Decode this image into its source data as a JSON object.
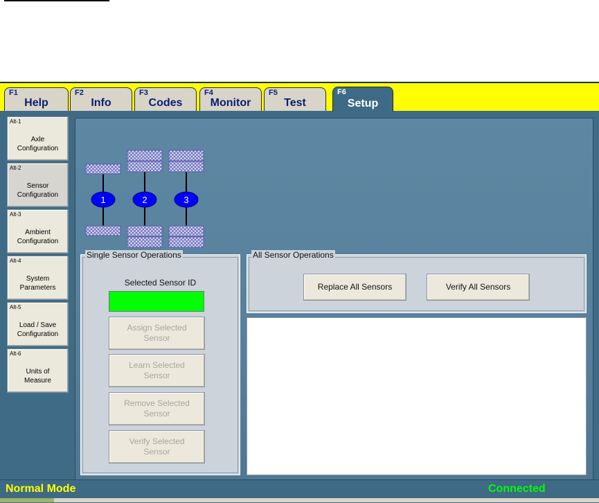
{
  "tabs": [
    {
      "fkey": "F1",
      "label": "Help"
    },
    {
      "fkey": "F2",
      "label": "Info"
    },
    {
      "fkey": "F3",
      "label": "Codes"
    },
    {
      "fkey": "F4",
      "label": "Monitor"
    },
    {
      "fkey": "F5",
      "label": "Test"
    },
    {
      "fkey": "F6",
      "label": "Setup"
    }
  ],
  "active_tab": "Setup",
  "sidebar": {
    "items": [
      {
        "key": "Alt-1",
        "label": "Axle\nConfiguration"
      },
      {
        "key": "Alt-2",
        "label": "Sensor\nConfiguration"
      },
      {
        "key": "Alt-3",
        "label": "Ambient\nConfiguration"
      },
      {
        "key": "Alt-4",
        "label": "System\nParameters"
      },
      {
        "key": "Alt-5",
        "label": "Load / Save\nConfiguration"
      },
      {
        "key": "Alt-6",
        "label": "Units of\nMeasure"
      }
    ],
    "active_item": "Sensor Configuration"
  },
  "axles": [
    {
      "number": "1",
      "tires_per_side": 1
    },
    {
      "number": "2",
      "tires_per_side": 2
    },
    {
      "number": "3",
      "tires_per_side": 2
    }
  ],
  "single_sensor": {
    "title": "Single Sensor Operations",
    "selected_label": "Selected Sensor ID",
    "selected_value": "",
    "assign": "Assign Selected\nSensor",
    "learn": "Learn Selected\nSensor",
    "remove": "Remove Selected\nSensor",
    "verify": "Verify Selected\nSensor"
  },
  "all_sensor": {
    "title": "All Sensor Operations",
    "replace": "Replace All Sensors",
    "verify": "Verify All Sensors"
  },
  "status": {
    "mode": "Normal Mode",
    "connection": "Connected"
  },
  "colors": {
    "tabbar": "#ffff00",
    "panel": "#5e87a3",
    "sensor_id_indicator": "#00ff00",
    "axle_badge": "#0000ff",
    "status_mode": "#ffff00",
    "status_connection": "#00ff00"
  }
}
